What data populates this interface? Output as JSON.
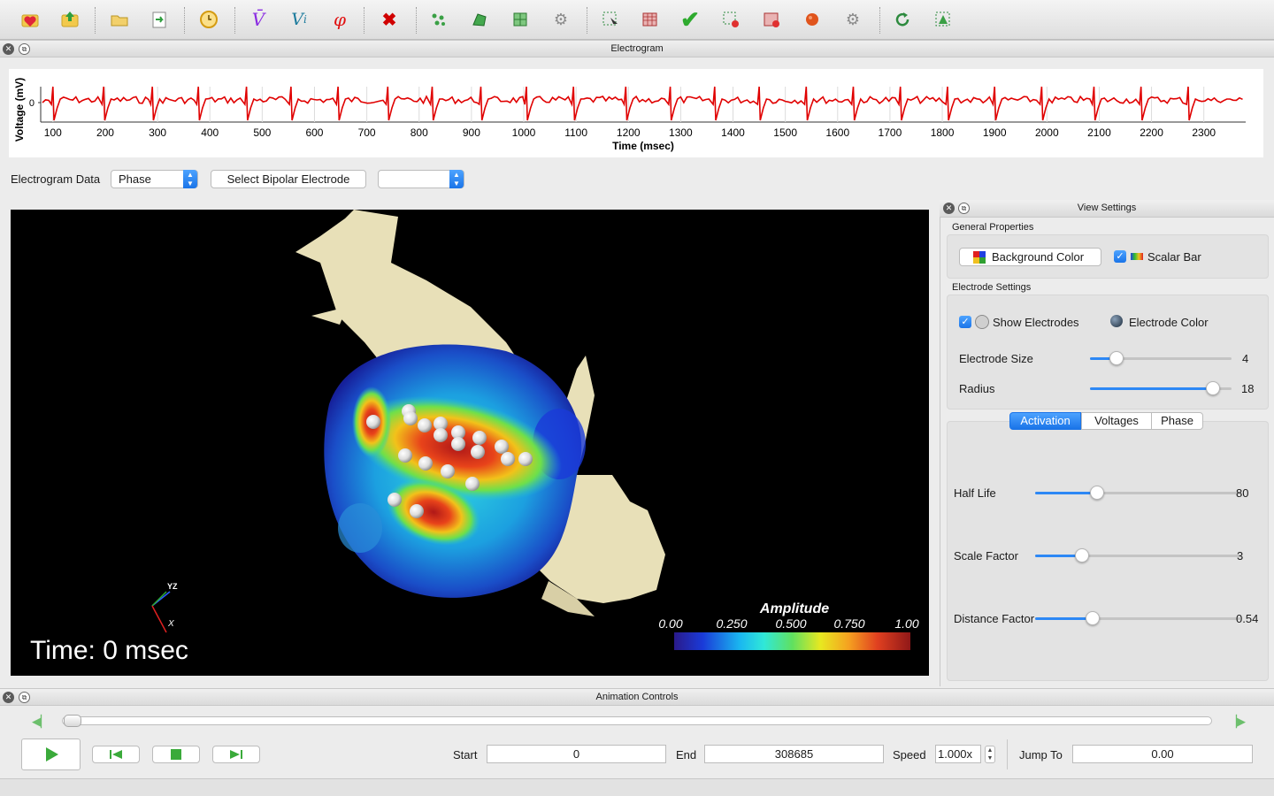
{
  "toolbar": {
    "icons": [
      "open-heart-icon",
      "import-icon",
      "folder-open-icon",
      "export-icon",
      "clock-icon",
      "v-bar-icon",
      "vi-icon",
      "phi-icon",
      "delete-icon",
      "points-icon",
      "mesh-icon",
      "grid-icon",
      "gear-icon",
      "select-icon",
      "surface-select-icon",
      "check-icon",
      "surface-point-icon",
      "surface-mesh-icon",
      "sphere-icon",
      "gear-icon-2",
      "refresh-icon",
      "triangle-select-icon"
    ]
  },
  "electrogram": {
    "title": "Electrogram",
    "ylabel": "Voltage (mV)",
    "xlabel": "Time (msec)",
    "y_tick": "0",
    "data_label": "Electrogram Data",
    "data_value": "Phase",
    "bipolar_button": "Select Bipolar Electrode",
    "bipolar_value": ""
  },
  "chart_data": {
    "type": "line",
    "title": "",
    "xlabel": "Time (msec)",
    "ylabel": "Voltage (mV)",
    "x_ticks": [
      "100",
      "200",
      "300",
      "400",
      "500",
      "600",
      "700",
      "800",
      "900",
      "1000",
      "1100",
      "1200",
      "1300",
      "1400",
      "1500",
      "1600",
      "1700",
      "1800",
      "1900",
      "2000",
      "2100",
      "2200",
      "2300"
    ],
    "xlim": [
      80,
      2380
    ],
    "beat_times": [
      100,
      197,
      290,
      378,
      470,
      555,
      645,
      740,
      825,
      918,
      1005,
      1095,
      1195,
      1280,
      1365,
      1450,
      1540,
      1630,
      1720,
      1810,
      1900,
      1990,
      2090,
      2180,
      2270
    ],
    "color": "#e00000"
  },
  "viewport": {
    "time_label": "Time: 0 msec",
    "scalar_bar_title": "Amplitude",
    "scalar_ticks": [
      "0.00",
      "0.250",
      "0.500",
      "0.750",
      "1.00"
    ],
    "axes_labels": {
      "yz": "YZ",
      "x": "X"
    }
  },
  "view_settings": {
    "title": "View Settings",
    "general_properties": "General Properties",
    "background_color": "Background Color",
    "scalar_bar": "Scalar Bar",
    "electrode_settings": "Electrode Settings",
    "show_electrodes": "Show Electrodes",
    "electrode_color": "Electrode Color",
    "electrode_size_label": "Electrode Size",
    "electrode_size_value": "4",
    "electrode_size_fraction": 0.19,
    "radius_label": "Radius",
    "radius_value": "18",
    "radius_fraction": 0.87,
    "tabs": [
      "Activation",
      "Voltages",
      "Phase"
    ],
    "half_life_label": "Half Life",
    "half_life_value": "80",
    "half_life_fraction": 0.3,
    "scale_factor_label": "Scale Factor",
    "scale_factor_value": "3",
    "scale_factor_fraction": 0.23,
    "distance_factor_label": "Distance Factor",
    "distance_factor_value": "0.54",
    "distance_factor_fraction": 0.28
  },
  "animation": {
    "title": "Animation Controls",
    "start_label": "Start",
    "start_value": "0",
    "end_label": "End",
    "end_value": "308685",
    "speed_label": "Speed",
    "speed_value": "1.000x",
    "jump_label": "Jump To",
    "jump_value": "0.00"
  }
}
